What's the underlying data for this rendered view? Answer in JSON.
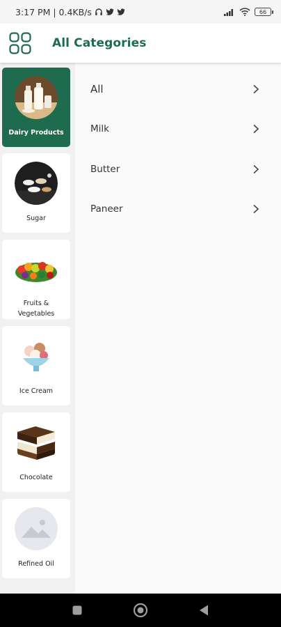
{
  "status_bar": {
    "time_speed": "3:17 PM | 0.4KB/s",
    "battery": "66"
  },
  "header": {
    "title": "All Categories",
    "menu_icon": "grid-icon"
  },
  "categories": [
    {
      "label": "Dairy Products",
      "icon": "milk-bottles-image",
      "active": true
    },
    {
      "label": "Sugar",
      "icon": "sugar-bowls-image",
      "active": false
    },
    {
      "label": "Fruits & Vegetables",
      "icon": "fruits-vegetables-image",
      "active": false
    },
    {
      "label": "Ice Cream",
      "icon": "ice-cream-bowl-image",
      "active": false
    },
    {
      "label": "Chocolate",
      "icon": "chocolate-pieces-image",
      "active": false
    },
    {
      "label": "Refined Oil",
      "icon": "image-placeholder-icon",
      "active": false
    }
  ],
  "subcategories": [
    {
      "label": "All"
    },
    {
      "label": "Milk"
    },
    {
      "label": "Butter"
    },
    {
      "label": "Paneer"
    }
  ],
  "colors": {
    "brand_green": "#1f6b4f",
    "background": "#f5f5f5"
  }
}
